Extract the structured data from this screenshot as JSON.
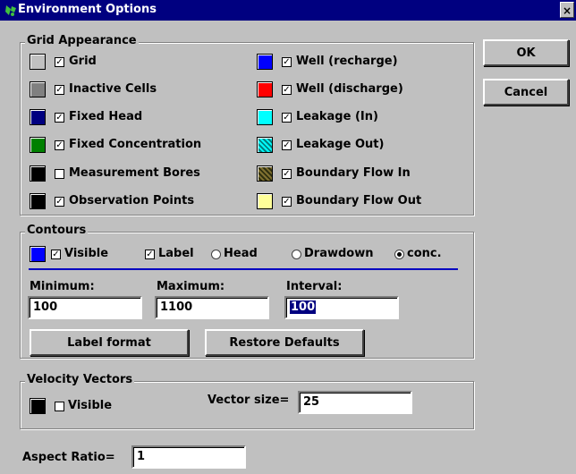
{
  "window": {
    "title": "Environment Options",
    "close_glyph": "×"
  },
  "buttons": {
    "ok": "OK",
    "cancel": "Cancel",
    "label_format": "Label format",
    "restore_defaults": "Restore Defaults"
  },
  "grid_appearance": {
    "legend": "Grid Appearance",
    "items": [
      {
        "label": "Grid",
        "checked": true,
        "color": "#c0c0c0"
      },
      {
        "label": "Inactive Cells",
        "checked": true,
        "color": "#808080"
      },
      {
        "label": "Fixed Head",
        "checked": true,
        "color": "#000080"
      },
      {
        "label": "Fixed Concentration",
        "checked": true,
        "color": "#008000"
      },
      {
        "label": "Measurement Bores",
        "checked": false,
        "color": "#000000"
      },
      {
        "label": "Observation Points",
        "checked": true,
        "color": "#000000"
      },
      {
        "label": "Well (recharge)",
        "checked": true,
        "color": "#0000ff"
      },
      {
        "label": "Well (discharge)",
        "checked": true,
        "color": "#ff0000"
      },
      {
        "label": "Leakage (In)",
        "checked": true,
        "color": "#00ffff"
      },
      {
        "label": "Leakage Out)",
        "checked": true,
        "color": "#00c0c0"
      },
      {
        "label": "Boundary Flow In",
        "checked": true,
        "color": "#5a5020"
      },
      {
        "label": "Boundary Flow Out",
        "checked": true,
        "color": "#ffff99"
      }
    ]
  },
  "contours": {
    "legend": "Contours",
    "color": "#0000ff",
    "visible_label": "Visible",
    "visible_checked": true,
    "label_label": "Label",
    "label_checked": true,
    "radio_head": "Head",
    "radio_drawdown": "Drawdown",
    "radio_conc": "conc.",
    "selected_radio": "conc.",
    "minimum_label": "Minimum:",
    "minimum_value": "100",
    "maximum_label": "Maximum:",
    "maximum_value": "1100",
    "interval_label": "Interval:",
    "interval_value": "100"
  },
  "velocity": {
    "legend": "Velocity Vectors",
    "color": "#000000",
    "visible_label": "Visible",
    "visible_checked": false,
    "size_label": "Vector size=",
    "size_value": "25"
  },
  "aspect": {
    "label": "Aspect Ratio=",
    "value": "1"
  },
  "checkmark": "✓"
}
